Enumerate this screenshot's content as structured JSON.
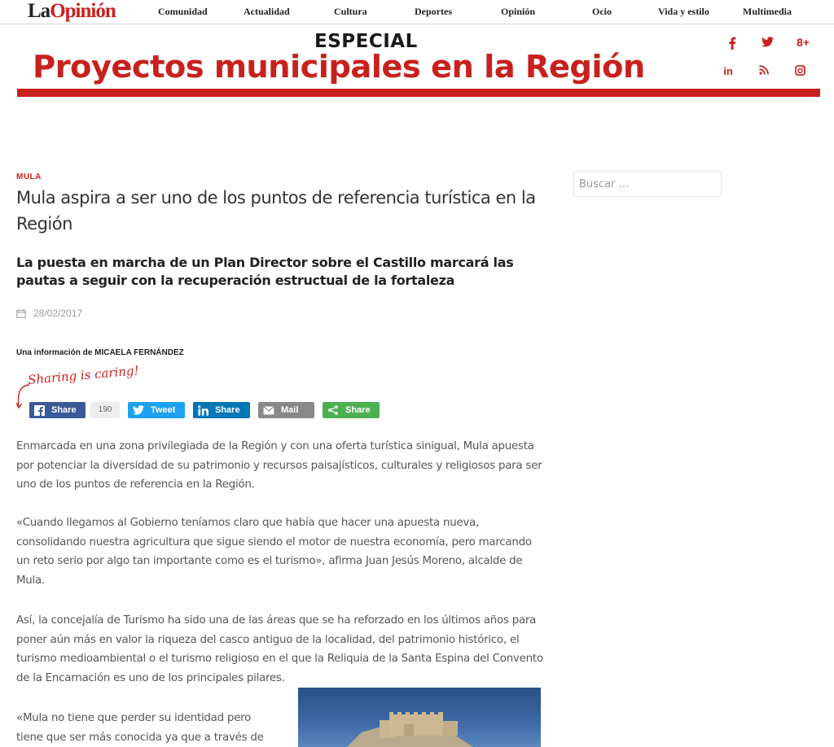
{
  "header": {
    "logo_la": "La",
    "logo_opinion": "Opinión",
    "nav": [
      "Comunidad",
      "Actualidad",
      "Cultura",
      "Deportes",
      "Opinión",
      "Ocio",
      "Vida y estilo",
      "Multimedia"
    ]
  },
  "banner": {
    "especial": "ESPECIAL",
    "title": "Proyectos municipales en la Región",
    "accent_color": "#c8211d",
    "social_icons": [
      "facebook-icon",
      "twitter-icon",
      "google-plus-icon",
      "linkedin-icon",
      "rss-icon",
      "instagram-icon"
    ],
    "google_plus_label": "8+",
    "linkedin_label": "in"
  },
  "article": {
    "category": "MULA",
    "title": "Mula aspira a ser uno de los puntos de referencia turística en la Región",
    "subtitle": "La puesta en marcha de un Plan Director sobre el Castillo marcará las pautas a seguir con la recuperación estructual de la fortaleza",
    "date": "28/02/2017",
    "byline": "Una información de MICAELA FERNÁNDEZ",
    "paragraphs": [
      "Enmarcada en una zona privilegiada de la Región y con una oferta turística sinigual, Mula apuesta por potenciar la diversidad de su patrimonio y recursos paisajísticos, culturales y religiosos para ser uno de los puntos de referencia en la Región.",
      "«Cuando llegamos al Gobierno teníamos claro que había que hacer una apuesta nueva, consolidando nuestra agricultura que sigue siendo el motor de nuestra economía, pero marcando un reto serio por algo tan importante como es el turismo», afirma Juan Jesús Moreno, alcalde de Mula.",
      "Así, la concejalía de Turismo ha sido una de las áreas que se ha reforzado en los últimos años para poner aún más en valor la riqueza del casco antiguo de la localidad, del patrimonio histórico, el turismo medioambiental o el turismo religioso en el que la Reliquia de la Santa Espina del Convento de la Encarnación es uno de los principales pilares.",
      "«Mula no tiene que perder su identidad pero tiene que ser más conocida ya que a través de"
    ]
  },
  "sharing": {
    "note": "Sharing is caring!",
    "buttons": [
      {
        "label": "Share",
        "color": "#3b5998",
        "icon": "facebook-icon"
      },
      {
        "label": "Tweet",
        "color": "#1da1f2",
        "icon": "twitter-icon"
      },
      {
        "label": "Share",
        "color": "#0077b5",
        "icon": "linkedin-icon"
      },
      {
        "label": "Mail",
        "color": "#888888",
        "icon": "mail-icon"
      },
      {
        "label": "Share",
        "color": "#4caf50",
        "icon": "sharethis-icon"
      }
    ],
    "facebook_count": "190"
  },
  "sidebar": {
    "search_placeholder": "Buscar …"
  }
}
